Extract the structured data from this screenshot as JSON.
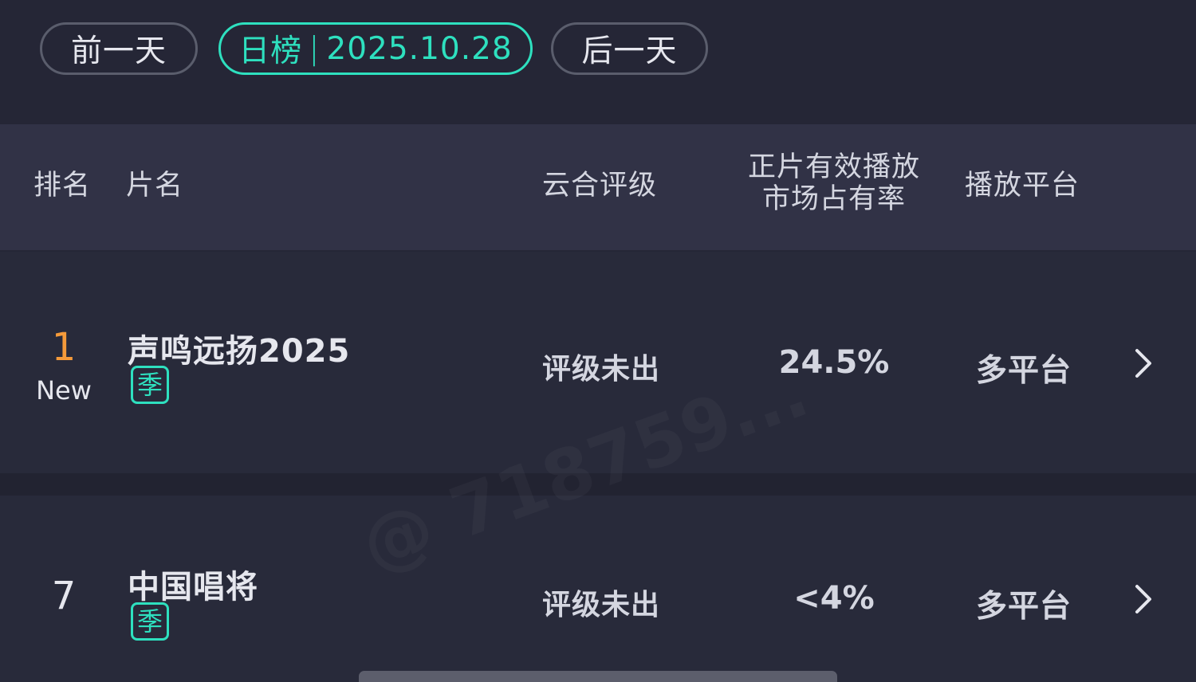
{
  "nav": {
    "prev_label": "前一天",
    "chart_type": "日榜",
    "separator": "|",
    "date": "2025.10.28",
    "next_label": "后一天"
  },
  "table": {
    "headers": {
      "rank": "排名",
      "title": "片名",
      "rating": "云合评级",
      "share_line1": "正片有效播放",
      "share_line2": "市场占有率",
      "platform": "播放平台"
    },
    "rows": [
      {
        "rank": "1",
        "rank_change": "New",
        "title": "声鸣远扬2025",
        "badge": "季",
        "rating": "评级未出",
        "share": "24.5%",
        "platform": "多平台"
      },
      {
        "rank": "7",
        "title": "中国唱将",
        "badge": "季",
        "rating": "评级未出",
        "share": "<4%",
        "platform": "多平台"
      }
    ]
  },
  "colors": {
    "accent": "#2ee0bf",
    "rank_top": "#f49a3a",
    "background": "#252636",
    "header_bg": "#313246",
    "row_bg": "#282a3a"
  },
  "watermark": "@ 718759..."
}
